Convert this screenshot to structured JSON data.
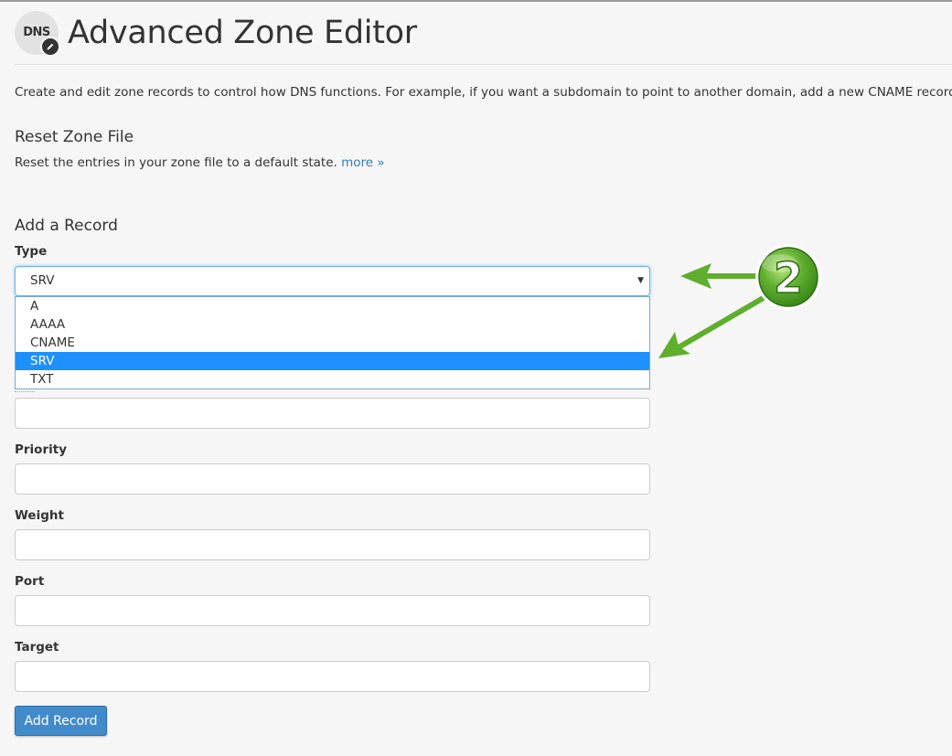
{
  "header": {
    "logo_text": "DNS",
    "title": "Advanced Zone Editor"
  },
  "intro": {
    "description": "Create and edit zone records to control how DNS functions. For example, if you want a subdomain to point to another domain, add a new CNAME record. For"
  },
  "reset_zone": {
    "heading": "Reset Zone File",
    "description": "Reset the entries in your zone file to a default state.",
    "more_link": "more »"
  },
  "add_record": {
    "heading": "Add a Record",
    "type_label": "Type",
    "type_value": "SRV",
    "type_options": [
      "A",
      "AAAA",
      "CNAME",
      "SRV",
      "TXT"
    ],
    "selected_option": "SRV",
    "priority_label": "Priority",
    "weight_label": "Weight",
    "port_label": "Port",
    "target_label": "Target",
    "submit_label": "Add Record"
  },
  "annotation": {
    "step_number": "2",
    "color": "#5fae2e"
  }
}
